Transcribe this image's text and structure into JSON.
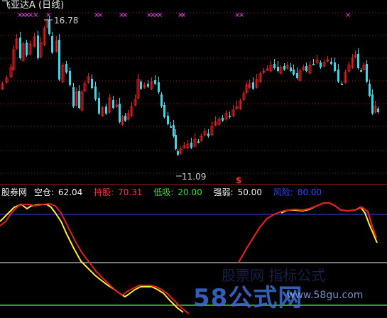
{
  "main_panel": {
    "title": "飞亚达A (日线)",
    "high_label": "16.78",
    "low_label": "11.09",
    "marker": "$",
    "cross_marker": "×"
  },
  "indicator_panel": {
    "name": "股券网",
    "items": [
      {
        "label": "空仓:",
        "value": "62.04",
        "color": "#f0f0f0"
      },
      {
        "label": "持股:",
        "value": "70.31",
        "color": "#ff3333"
      },
      {
        "label": "低吸:",
        "value": "20.00",
        "color": "#33dd33"
      },
      {
        "label": "强弱:",
        "value": "50.00",
        "color": "#f0f0f0"
      },
      {
        "label": "风险:",
        "value": "80.00",
        "color": "#3344ff"
      }
    ]
  },
  "watermark": {
    "brand": "58公式网",
    "url": "www.58gu.com",
    "faint": "股票网  指标公式"
  },
  "colors": {
    "up": "#e02020",
    "down": "#38d8e8",
    "grid": "#8a1a1a",
    "risk": "#3344ff",
    "strength": "#f0f0f0",
    "buy": "#33dd33",
    "yellow": "#ffee33"
  },
  "chart_data": {
    "type": "candlestick+indicator",
    "title": "飞亚达A (日线)",
    "price_high": 16.78,
    "price_low": 11.09,
    "indicator_levels": {
      "空仓": 62.04,
      "持股": 70.31,
      "低吸": 20.0,
      "强弱": 50.0,
      "风险": 80.0
    }
  }
}
